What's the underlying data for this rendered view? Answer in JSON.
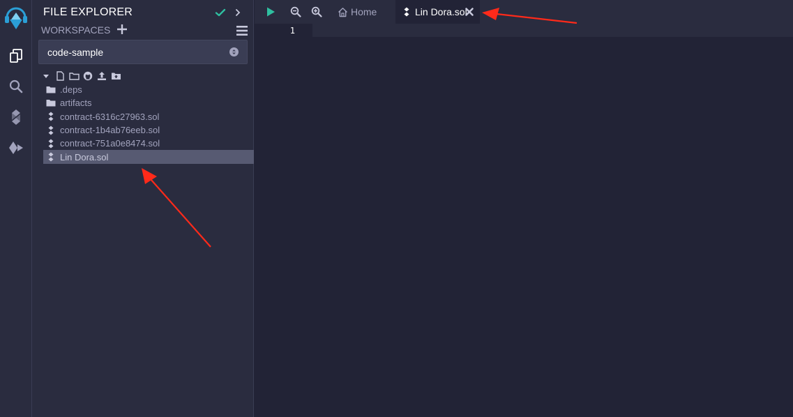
{
  "panel": {
    "title": "FILE EXPLORER",
    "workspaces_label": "WORKSPACES",
    "workspace_selected": "code-sample"
  },
  "tree": {
    "items": [
      {
        "name": ".deps",
        "kind": "folder",
        "icon": "folder-icon"
      },
      {
        "name": "artifacts",
        "kind": "folder",
        "icon": "folder-icon"
      },
      {
        "name": "contract-6316c27963.sol",
        "kind": "file",
        "icon": "solidity-icon"
      },
      {
        "name": "contract-1b4ab76eeb.sol",
        "kind": "file",
        "icon": "solidity-icon"
      },
      {
        "name": "contract-751a0e8474.sol",
        "kind": "file",
        "icon": "solidity-icon"
      },
      {
        "name": "Lin Dora.sol",
        "kind": "file",
        "icon": "solidity-icon",
        "selected": true
      }
    ]
  },
  "editor": {
    "tabs": [
      {
        "label": "Home",
        "icon": "home-icon"
      },
      {
        "label": "Lin Dora.sol",
        "icon": "solidity-icon",
        "active": true
      }
    ],
    "line_numbers": [
      "1"
    ]
  },
  "colors": {
    "accent_green": "#2fbfa0",
    "annotation_red": "#ff2a1a",
    "selected_row": "#575a72",
    "panel_bg": "#2a2c3f",
    "editor_bg": "#222336"
  }
}
